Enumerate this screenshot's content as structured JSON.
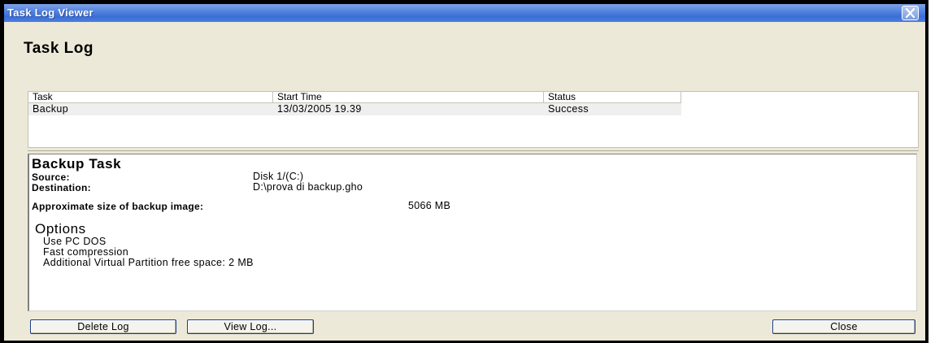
{
  "window": {
    "title": "Task Log Viewer",
    "close_glyph": "✕"
  },
  "header": {
    "title": "Task Log"
  },
  "log_table": {
    "columns": [
      "Task",
      "Start Time",
      "Status"
    ],
    "rows": [
      {
        "task": "Backup",
        "start_time": "13/03/2005 19.39",
        "status": "Success"
      }
    ]
  },
  "details": {
    "title": "Backup Task",
    "source_label": "Source:",
    "source_value": "Disk 1/(C:)",
    "destination_label": "Destination:",
    "destination_value": "D:\\prova di backup.gho",
    "size_label": "Approximate size of backup image:",
    "size_value": "5066 MB",
    "options_title": "Options",
    "options": [
      "Use PC DOS",
      "Fast compression",
      "Additional Virtual Partition free space: 2 MB"
    ]
  },
  "buttons": {
    "delete_log": "Delete Log",
    "view_log": "View Log...",
    "close": "Close"
  },
  "colors": {
    "titlebar": "#3a6ed6",
    "dialog_bg": "#ece9d8",
    "row_highlight": "#efefef"
  }
}
